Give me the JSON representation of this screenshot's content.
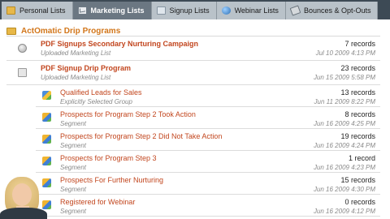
{
  "tabs": [
    {
      "label": "Personal Lists",
      "icon": "folder-icon",
      "active": false
    },
    {
      "label": "Marketing Lists",
      "icon": "envelope-icon",
      "active": true
    },
    {
      "label": "Signup Lists",
      "icon": "form-icon",
      "active": false
    },
    {
      "label": "Webinar Lists",
      "icon": "globe-icon",
      "active": false
    },
    {
      "label": "Bounces & Opt-Outs",
      "icon": "bounce-icon",
      "active": false
    }
  ],
  "section": {
    "title": "ActOmatic Drip Programs"
  },
  "rows": [
    {
      "name": "PDF Signups Secondary Nurturing Campaign",
      "type": "Uploaded Marketing List",
      "count": "7 records",
      "date": "Jul 10 2009 4:13 PM",
      "icon": "disk-icon",
      "sub": false
    },
    {
      "name": "PDF Signup Drip Program",
      "type": "Uploaded Marketing List",
      "count": "23 records",
      "date": "Jun 15 2009 5:58 PM",
      "icon": "document-icon",
      "sub": false
    },
    {
      "name": "Qualified Leads for Sales",
      "type": "Explicitly Selected Group",
      "count": "13 records",
      "date": "Jun 11 2009 8:22 PM",
      "icon": "group-icon",
      "sub": true
    },
    {
      "name": "Prospects for Program Step 2 Took Action",
      "type": "Segment",
      "count": "8 records",
      "date": "Jun 16 2009 4:25 PM",
      "icon": "segment-icon",
      "sub": true
    },
    {
      "name": "Prospects for Program Step 2 Did Not Take Action",
      "type": "Segment",
      "count": "19 records",
      "date": "Jun 16 2009 4:24 PM",
      "icon": "segment-icon",
      "sub": true
    },
    {
      "name": "Prospects for Program Step 3",
      "type": "Segment",
      "count": "1 record",
      "date": "Jun 16 2009 4:23 PM",
      "icon": "segment-icon",
      "sub": true
    },
    {
      "name": "Prospects For Further Nurturing",
      "type": "Segment",
      "count": "15 records",
      "date": "Jun 16 2009 4:30 PM",
      "icon": "segment-icon",
      "sub": true
    },
    {
      "name": "Registered for Webinar",
      "type": "Segment",
      "count": "0 records",
      "date": "Jun 16 2009 4:12 PM",
      "icon": "segment-icon",
      "sub": true
    }
  ]
}
